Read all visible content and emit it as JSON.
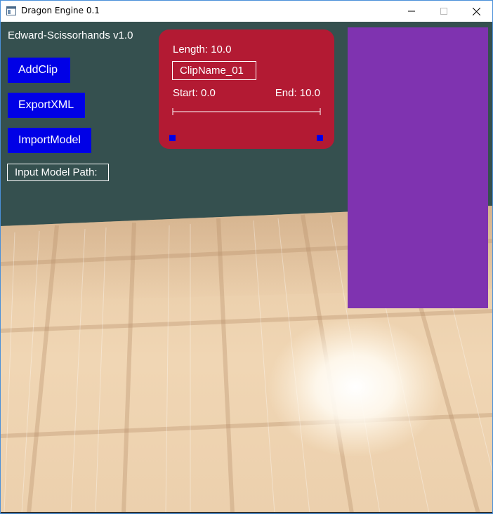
{
  "window": {
    "title": "Dragon Engine 0.1",
    "controls": [
      "minimize-icon",
      "maximize-icon",
      "close-icon"
    ]
  },
  "viewport": {
    "app_label": "Edward-Scissorhands v1.0",
    "buttons": {
      "add_clip": "AddClip",
      "export_xml": "ExportXML",
      "import_model": "ImportModel"
    },
    "model_path_field": "Input Model Path:"
  },
  "clip_panel": {
    "length": "Length: 10.0",
    "name": "ClipName_01",
    "start": "Start: 0.0",
    "end": "End: 10.0"
  },
  "colors": {
    "background": "#35504f",
    "button": "#0000e6",
    "clip_panel": "#b31a33",
    "side_panel": "#7f33b0"
  }
}
